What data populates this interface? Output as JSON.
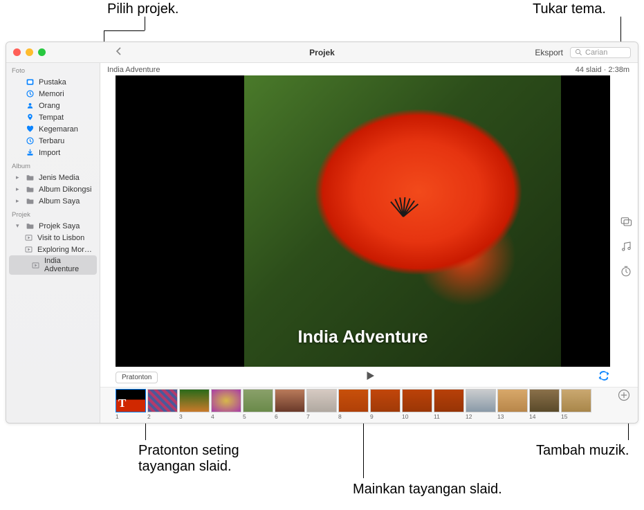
{
  "callouts": {
    "select_project": "Pilih projek.",
    "change_theme": "Tukar tema.",
    "preview_settings": "Pratonton seting\ntayangan slaid.",
    "add_music": "Tambah muzik.",
    "play_slideshow": "Mainkan tayangan slaid."
  },
  "toolbar": {
    "title": "Projek",
    "export": "Eksport",
    "search_placeholder": "Carian"
  },
  "project": {
    "name": "India Adventure",
    "slide_count": "44 slaid",
    "duration": "2:38m",
    "overlay_title": "India Adventure"
  },
  "controls": {
    "preview": "Pratonton"
  },
  "sidebar": {
    "sections": [
      {
        "header": "Foto",
        "items": [
          {
            "label": "Pustaka",
            "icon": "library"
          },
          {
            "label": "Memori",
            "icon": "memories"
          },
          {
            "label": "Orang",
            "icon": "people"
          },
          {
            "label": "Tempat",
            "icon": "pin"
          },
          {
            "label": "Kegemaran",
            "icon": "heart"
          },
          {
            "label": "Terbaru",
            "icon": "clock"
          },
          {
            "label": "Import",
            "icon": "import"
          }
        ]
      },
      {
        "header": "Album",
        "items": [
          {
            "label": "Jenis Media",
            "icon": "folder",
            "disclosure": true
          },
          {
            "label": "Album Dikongsi",
            "icon": "folder",
            "disclosure": true
          },
          {
            "label": "Album Saya",
            "icon": "folder",
            "disclosure": true
          }
        ]
      },
      {
        "header": "Projek",
        "items": [
          {
            "label": "Projek Saya",
            "icon": "folder",
            "expanded": true,
            "children": [
              {
                "label": "Visit to Lisbon",
                "icon": "slideshow"
              },
              {
                "label": "Exploring Mor…",
                "icon": "slideshow"
              },
              {
                "label": "India Adventure",
                "icon": "slideshow",
                "selected": true
              }
            ]
          }
        ]
      }
    ]
  },
  "thumbs": [
    {
      "n": "1",
      "bg": "linear-gradient(#000 45%, #d02800 45%)",
      "t": true
    },
    {
      "n": "2",
      "bg": "repeating-linear-gradient(45deg,#4a5a9a 0 4px,#b43a6a 4px 8px)"
    },
    {
      "n": "3",
      "bg": "linear-gradient(#2a6a1a,#c97a2a)"
    },
    {
      "n": "4",
      "bg": "radial-gradient(#d6b84a,#a83aa8)"
    },
    {
      "n": "5",
      "bg": "linear-gradient(#8aa06a,#6a8a4a)"
    },
    {
      "n": "6",
      "bg": "linear-gradient(#b97a5a,#6a3a2a)"
    },
    {
      "n": "7",
      "bg": "linear-gradient(#d6cac2,#b0a8a0)"
    },
    {
      "n": "8",
      "bg": "linear-gradient(#c8500a,#b04008)"
    },
    {
      "n": "9",
      "bg": "linear-gradient(#c2460a,#a03a08)"
    },
    {
      "n": "10",
      "bg": "linear-gradient(#bc4208,#9a3606)"
    },
    {
      "n": "11",
      "bg": "linear-gradient(#b84008,#963406)"
    },
    {
      "n": "12",
      "bg": "linear-gradient(#caccce,#8a9aa8)"
    },
    {
      "n": "13",
      "bg": "linear-gradient(#d8a86a,#b8864a)"
    },
    {
      "n": "14",
      "bg": "linear-gradient(#8a704a,#5a4a2a)"
    },
    {
      "n": "15",
      "bg": "linear-gradient(#caa870,#a8864a)"
    }
  ]
}
